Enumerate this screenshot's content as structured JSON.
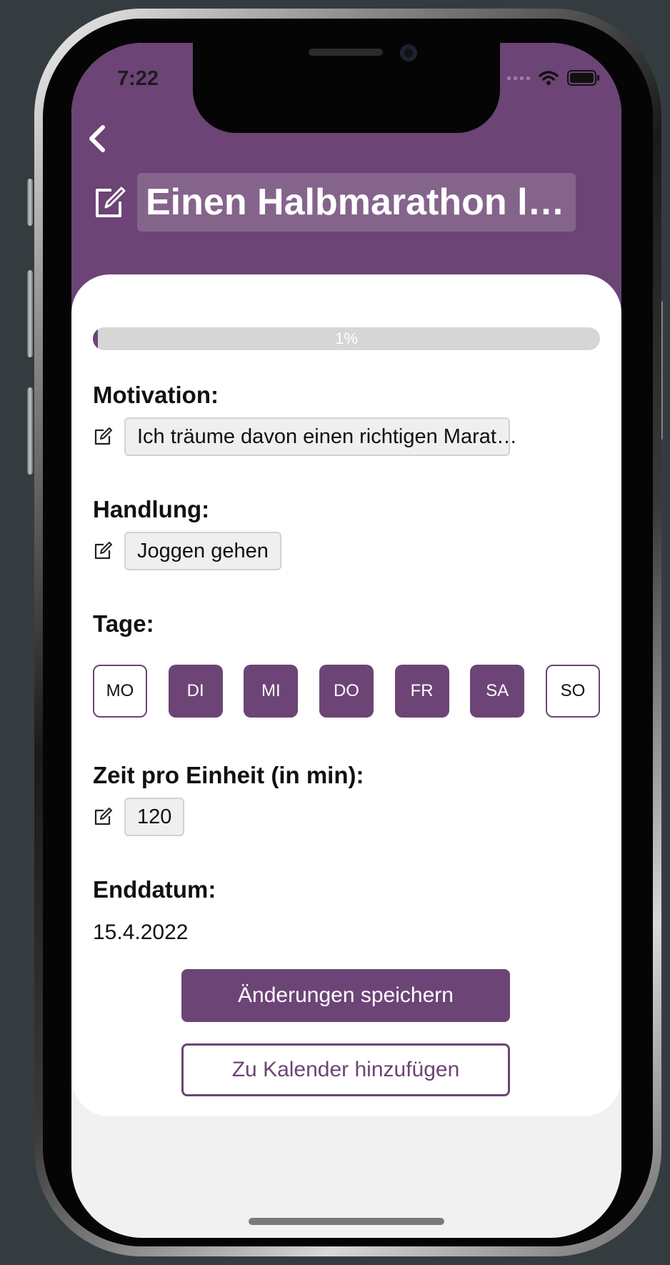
{
  "status_bar": {
    "time": "7:22"
  },
  "header": {
    "title": "Einen Halbmarathon l…",
    "icons": [
      "chevron-left-icon",
      "edit-icon"
    ]
  },
  "progress": {
    "value": 0.01,
    "label": "1%"
  },
  "motivation": {
    "label": "Motivation:",
    "value": "Ich träume davon einen richtigen Marat…"
  },
  "handlung": {
    "label": "Handlung:",
    "value": "Joggen gehen"
  },
  "tage": {
    "label": "Tage:",
    "days": [
      {
        "label": "MO",
        "selected": false
      },
      {
        "label": "DI",
        "selected": true
      },
      {
        "label": "MI",
        "selected": true
      },
      {
        "label": "DO",
        "selected": true
      },
      {
        "label": "FR",
        "selected": true
      },
      {
        "label": "SA",
        "selected": true
      },
      {
        "label": "SO",
        "selected": false
      }
    ]
  },
  "zeit": {
    "label": "Zeit pro Einheit (in min):",
    "value": "120"
  },
  "enddatum": {
    "label": "Enddatum:",
    "value": "15.4.2022"
  },
  "buttons": {
    "save": "Änderungen speichern",
    "calendar": "Zu Kalender hinzufügen"
  },
  "colors": {
    "accent": "#6c4476",
    "field_bg": "#efefef",
    "progress_track": "#d6d6d6"
  }
}
